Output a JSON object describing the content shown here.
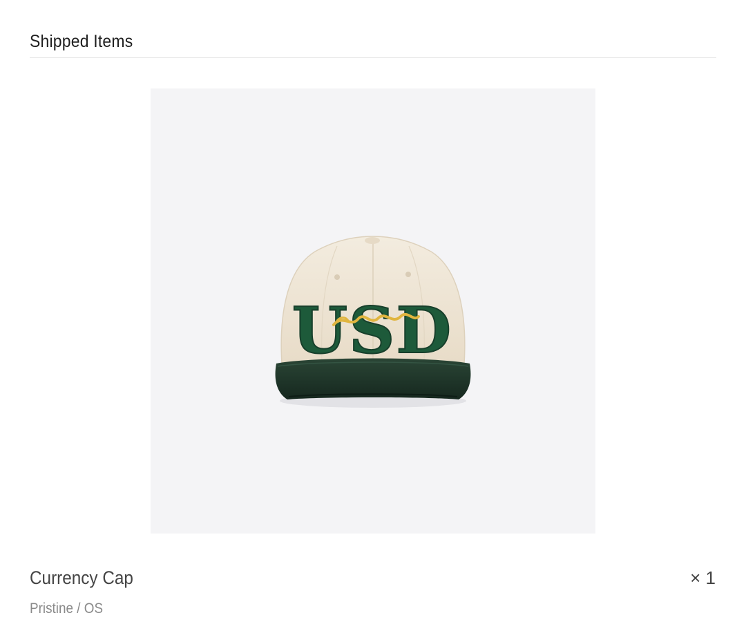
{
  "section": {
    "title": "Shipped Items"
  },
  "product": {
    "image_icon": "cap-photo",
    "cap_lettering": "USD",
    "name": "Currency Cap",
    "quantity": "× 1",
    "variant": "Pristine / OS"
  },
  "colors": {
    "crown": "#efe6d6",
    "brim": "#1f3a2c",
    "letters": "#1d5a3a",
    "script": "#e0b53f",
    "image_bg": "#f4f4f6"
  }
}
